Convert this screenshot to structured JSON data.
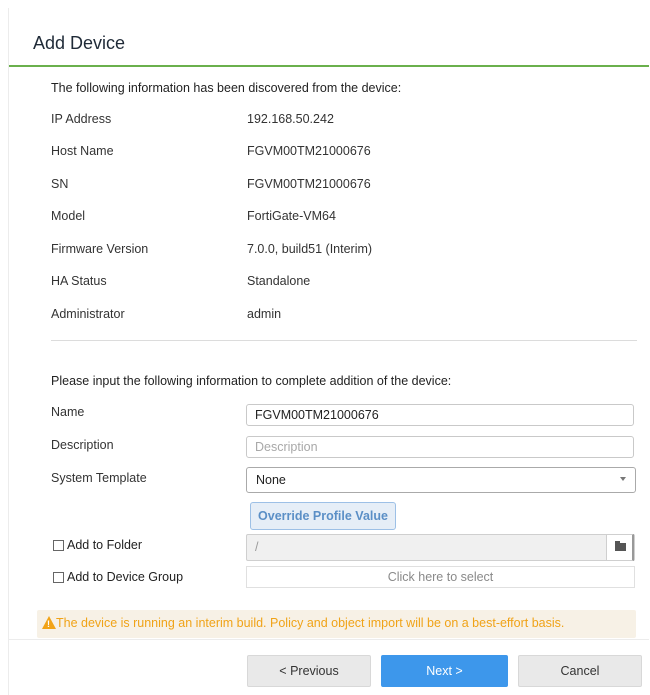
{
  "dialog": {
    "title": "Add Device",
    "discovered_intro": "The following information has been discovered from the device:",
    "info": [
      {
        "label": "IP Address",
        "value": "192.168.50.242"
      },
      {
        "label": "Host Name",
        "value": "FGVM00TM21000676"
      },
      {
        "label": "SN",
        "value": "FGVM00TM21000676"
      },
      {
        "label": "Model",
        "value": "FortiGate-VM64"
      },
      {
        "label": "Firmware Version",
        "value": "7.0.0, build51 (Interim)"
      },
      {
        "label": "HA Status",
        "value": "Standalone"
      },
      {
        "label": "Administrator",
        "value": "admin"
      }
    ],
    "input_intro": "Please input the following information to complete addition of the device:",
    "form": {
      "name_label": "Name",
      "name_value": "FGVM00TM21000676",
      "description_label": "Description",
      "description_placeholder": "Description",
      "system_template_label": "System Template",
      "system_template_value": "None",
      "override_button": "Override Profile Value",
      "add_to_folder_label": "Add to Folder",
      "folder_value": "/",
      "add_to_device_group_label": "Add to Device Group",
      "device_group_placeholder": "Click here to select"
    },
    "warning": {
      "text": "The device is running an interim build. Policy and object import will be on a best-effort basis.",
      "color": "#f0a318"
    },
    "buttons": {
      "previous": "< Previous",
      "next": "Next >",
      "cancel": "Cancel"
    },
    "colors": {
      "accent_line": "#6ab04c",
      "primary_button": "#3d97eb"
    }
  }
}
